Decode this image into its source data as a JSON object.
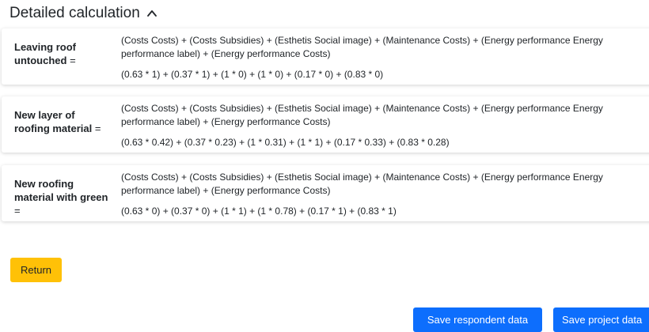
{
  "header": {
    "title": "Detailed calculation",
    "toggle_icon": "caret-up-icon"
  },
  "options": [
    {
      "label": "Leaving roof untouched",
      "equals": "=",
      "formula": "(Costs Costs) + (Costs Subsidies) + (Esthetis Social image) + (Maintenance Costs) + (Energy performance Energy performance label) + (Energy performance Costs)",
      "values": "(0.63 * 1) + (0.37 * 1) + (1 * 0) + (1 * 0) + (0.17 * 0) + (0.83 * 0)"
    },
    {
      "label": "New layer of roofing material",
      "equals": "=",
      "formula": "(Costs Costs) + (Costs Subsidies) + (Esthetis Social image) + (Maintenance Costs) + (Energy performance Energy performance label) + (Energy performance Costs)",
      "values": "(0.63 * 0.42) + (0.37 * 0.23) + (1 * 0.31) + (1 * 1) + (0.17 * 0.33) + (0.83 * 0.28)"
    },
    {
      "label": "New roofing material with green",
      "equals": "=",
      "formula": "(Costs Costs) + (Costs Subsidies) + (Esthetis Social image) + (Maintenance Costs) + (Energy performance Energy performance label) + (Energy performance Costs)",
      "values": "(0.63 * 0) + (0.37 * 0) + (1 * 1) + (1 * 0.78) + (0.17 * 1) + (0.83 * 1)"
    }
  ],
  "buttons": {
    "return_label": "Return",
    "save_respondent_label": "Save respondent data",
    "save_project_label": "Save project data"
  },
  "colors": {
    "return_button": "#ffc107",
    "primary_button": "#0d6efd"
  }
}
